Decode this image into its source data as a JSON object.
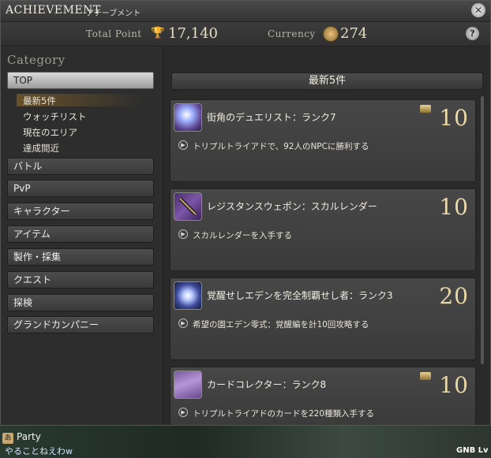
{
  "window": {
    "title": "ACHIEVEMENT",
    "subtitle": "アチーブメント",
    "close_icon": "close-icon"
  },
  "stats": {
    "total_point_label": "Total Point",
    "total_point_value": "17,140",
    "currency_label": "Currency",
    "currency_value": "274",
    "help_label": "?"
  },
  "sidebar": {
    "heading": "Category",
    "top_label": "TOP",
    "sub_items": [
      "最新5件",
      "ウォッチリスト",
      "現在のエリア",
      "達成間近"
    ],
    "categories": [
      "バトル",
      "PvP",
      "キャラクター",
      "アイテム",
      "製作・採集",
      "クエスト",
      "探検",
      "グランドカンパニー"
    ]
  },
  "main": {
    "section_title": "最新5件",
    "cards": [
      {
        "title": "街角のデュエリスト：ランク7",
        "description": "トリプルトライアドで、92人のNPCに勝利する",
        "points": "10",
        "has_chest": true,
        "icon": "duelist-card-icon"
      },
      {
        "title": "レジスタンスウェポン：スカルレンダー",
        "description": "スカルレンダーを入手する",
        "points": "10",
        "has_chest": false,
        "icon": "gunblade-icon"
      },
      {
        "title": "覚醒せしエデンを完全制覇せし者：ランク3",
        "description": "希望の園エデン零式：覚醒編を計10回攻略する",
        "points": "20",
        "has_chest": false,
        "icon": "eden-crystal-icon"
      },
      {
        "title": "カードコレクター：ランク8",
        "description": "トリプルトライアドのカードを220種類入手する",
        "points": "10",
        "has_chest": true,
        "icon": "card-collector-icon"
      }
    ]
  },
  "bottom": {
    "party_label": "Party",
    "party_member": "やることねえわw",
    "job": "GNB Lv"
  },
  "colors": {
    "gold": "#ead7a6",
    "highlight": "#966e28"
  }
}
